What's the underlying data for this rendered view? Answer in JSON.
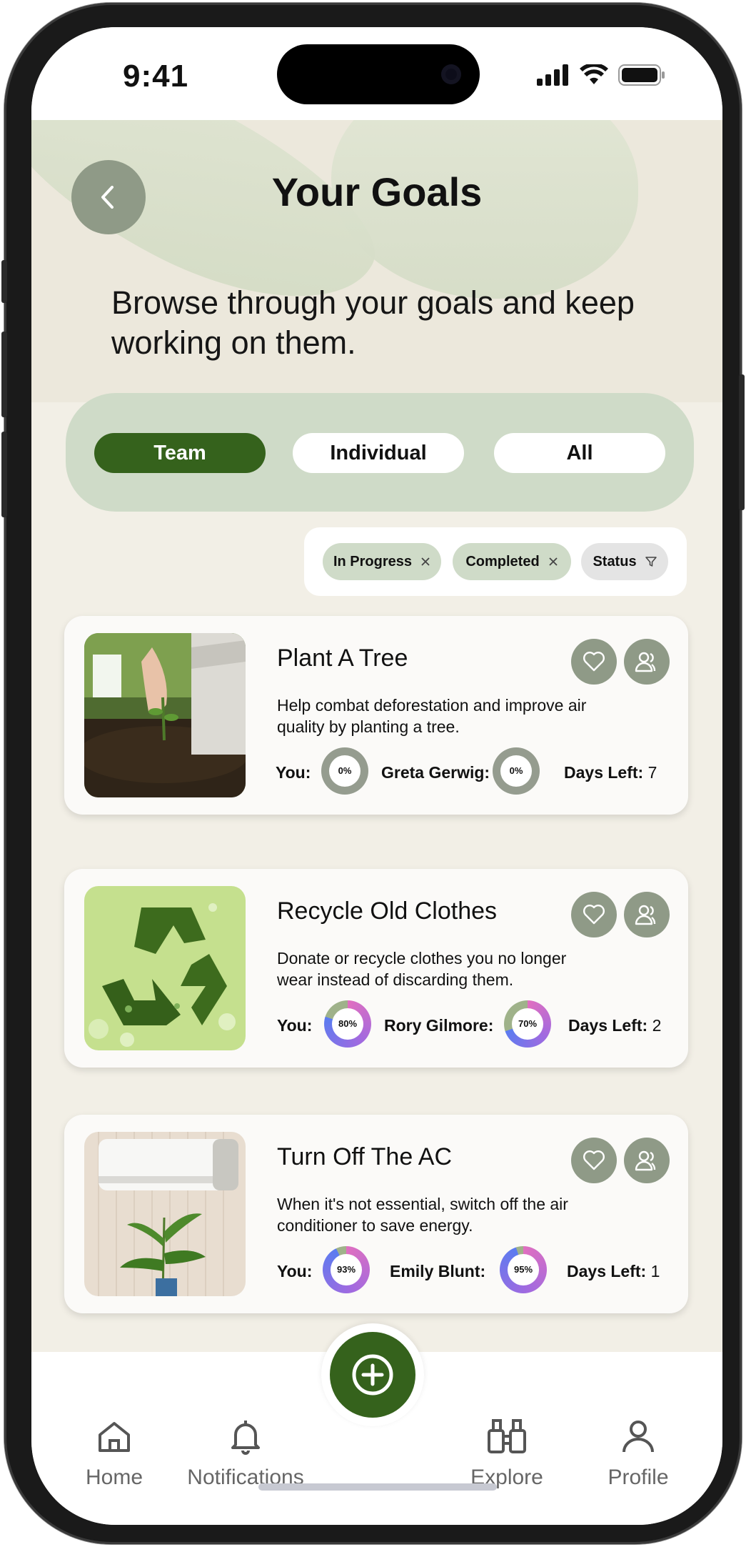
{
  "status_bar": {
    "time": "9:41"
  },
  "header": {
    "title": "Your Goals",
    "subtitle": "Browse through your goals and keep working on them."
  },
  "tabs": [
    {
      "label": "Team",
      "active": true
    },
    {
      "label": "Individual",
      "active": false
    },
    {
      "label": "All",
      "active": false
    }
  ],
  "filters": {
    "chips": [
      {
        "label": "In Progress",
        "icon": "close-icon"
      },
      {
        "label": "Completed",
        "icon": "close-icon"
      }
    ],
    "status": {
      "label": "Status",
      "icon": "filter-icon"
    }
  },
  "goals": [
    {
      "title": "Plant A Tree",
      "description": "Help combat deforestation and improve air quality by planting a tree.",
      "you_label": "You:",
      "you_progress": "0%",
      "you_value": 0,
      "partner_label": "Greta Gerwig:",
      "partner_progress": "0%",
      "partner_value": 0,
      "days_left_label": "Days Left:",
      "days_left": "7"
    },
    {
      "title": "Recycle Old Clothes",
      "description": "Donate or recycle clothes you no longer wear instead of discarding them.",
      "you_label": "You:",
      "you_progress": "80%",
      "you_value": 80,
      "partner_label": "Rory Gilmore:",
      "partner_progress": "70%",
      "partner_value": 70,
      "days_left_label": "Days Left:",
      "days_left": "2"
    },
    {
      "title": "Turn Off The AC",
      "description": "When it's not essential, switch off the air conditioner to save energy.",
      "you_label": "You:",
      "you_progress": "93%",
      "you_value": 93,
      "partner_label": "Emily Blunt:",
      "partner_progress": "95%",
      "partner_value": 95,
      "days_left_label": "Days Left:",
      "days_left": "1"
    }
  ],
  "bottom_nav": {
    "home": "Home",
    "notifications": "Notifications",
    "explore": "Explore",
    "profile": "Profile"
  },
  "colors": {
    "accent": "#35621c",
    "tab_bg": "#cfdbc8",
    "icon_btn": "#8f9a87",
    "background": "#f2efe6"
  }
}
